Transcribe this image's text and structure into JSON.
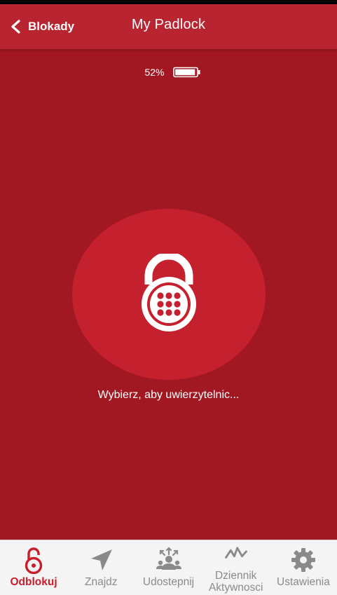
{
  "colors": {
    "background": "#a11822",
    "header": "#b82430",
    "circle": "#c5202e",
    "accent": "#c81d2b",
    "tab_inactive": "#8a8a8a",
    "tabbar_bg": "#f4f4f4"
  },
  "header": {
    "back_label": "Blokady",
    "back_icon": "chevron-left-icon",
    "title": "My Padlock"
  },
  "battery": {
    "percent_label": "52%",
    "level": 0.95,
    "icon": "battery-icon"
  },
  "main": {
    "lock_icon": "padlock-keypad-icon",
    "prompt": "Wybierz, aby uwierzytelnic..."
  },
  "tabs": [
    {
      "label": "Odblokuj",
      "icon": "unlocked-padlock-icon",
      "active": true
    },
    {
      "label": "Znajdz",
      "icon": "navigation-arrow-icon",
      "active": false
    },
    {
      "label": "Udostepnij",
      "icon": "share-people-icon",
      "active": false
    },
    {
      "label_line1": "Dziennik",
      "label_line2": "Aktywnosci",
      "icon": "activity-graph-icon",
      "active": false
    },
    {
      "label": "Ustawienia",
      "icon": "gear-icon",
      "active": false
    }
  ]
}
